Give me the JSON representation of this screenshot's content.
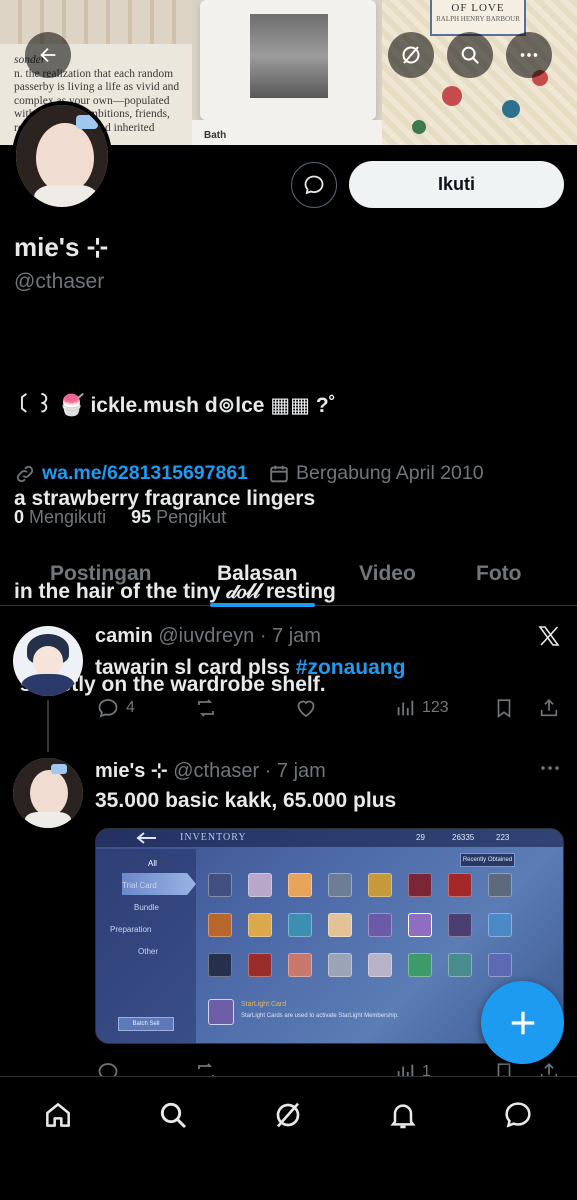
{
  "banner": {
    "note_text": "n. the realization that each random passerby is living a life as vivid and complex as your own—populated with their own ambitions, friends, routines, worries and inherited craziness.",
    "note_word": "sonder",
    "card_label": "Bath",
    "book_title": "OF LOVE",
    "book_author": "RALPH HENRY BARBOUR"
  },
  "header_actions": {
    "back_icon": "arrow-left-icon",
    "grok_icon": "slash-circle-icon",
    "search_icon": "search-icon",
    "more_icon": "more-icon"
  },
  "profile": {
    "display_name": "mie's ⊹",
    "handle": "@cthaser",
    "bio_lines": [
      "〔 ꒱ 🍧 ickle.mush d⊚lce ▦▦ ?˚",
      "a strawberry fragrance lingers",
      "in the hair of the tiny 𝒹𝑜𝓁𝓁 resting",
      " sweetly on the wardrobe shelf."
    ],
    "link": "wa.me/6281315697861",
    "joined": "Bergabung April 2010",
    "following_count": "0",
    "following_label": "Mengikuti",
    "followers_count": "95",
    "followers_label": "Pengikut",
    "follow_button": "Ikuti"
  },
  "tabs": [
    {
      "label": "Postingan",
      "active": false
    },
    {
      "label": "Balasan",
      "active": true
    },
    {
      "label": "Video",
      "active": false
    },
    {
      "label": "Foto",
      "active": false
    }
  ],
  "posts": [
    {
      "name": "camin",
      "handle": "@iuvdreyn",
      "time": "· 7 jam",
      "text": "tawarin sl card plss ",
      "hashtag": "#zonauang",
      "reply_count": "4",
      "retweet_count": "",
      "like_count": "",
      "view_count": "123"
    },
    {
      "name": "mie's ⊹",
      "handle": "@cthaser",
      "time": "· 7 jam",
      "text": "35.000 basic kakk, 65.000 plus",
      "reply_count": "",
      "retweet_count": "",
      "like_count": "",
      "view_count": "1"
    }
  ],
  "game_screenshot": {
    "title": "INVENTORY",
    "stat1": "29",
    "stat2": "26335",
    "stat3": "223",
    "recent_button": "Recently Obtained",
    "categories": [
      "All",
      "Trial Card",
      "Bundle",
      "Preparation",
      "Other"
    ],
    "batch_button": "Batch Sell",
    "item_title": "StarLight Card",
    "item_desc": "StarLight Cards are used to activate StarLight Membership."
  },
  "nav": [
    "home-icon",
    "search-icon",
    "grok-icon",
    "notifications-icon",
    "messages-icon"
  ],
  "colors": {
    "accent": "#1d9bf0",
    "muted": "#71767b",
    "text": "#e7e9ea",
    "bg": "#000000"
  }
}
